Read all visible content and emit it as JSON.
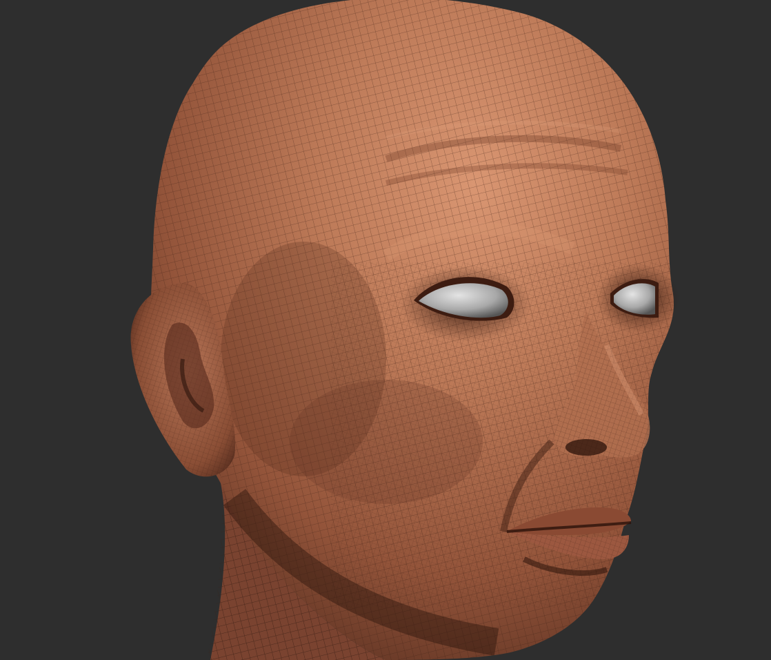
{
  "viewport": {
    "background_color": "#2e2e2e",
    "subject": "wireframe-head-sculpt"
  },
  "model": {
    "skin_color": "#b87858",
    "skin_highlight_color": "#d69270",
    "skin_shadow_color": "#5a2f20",
    "wire_color": "#3a1e14",
    "eye_color": "#b8b8b8"
  }
}
